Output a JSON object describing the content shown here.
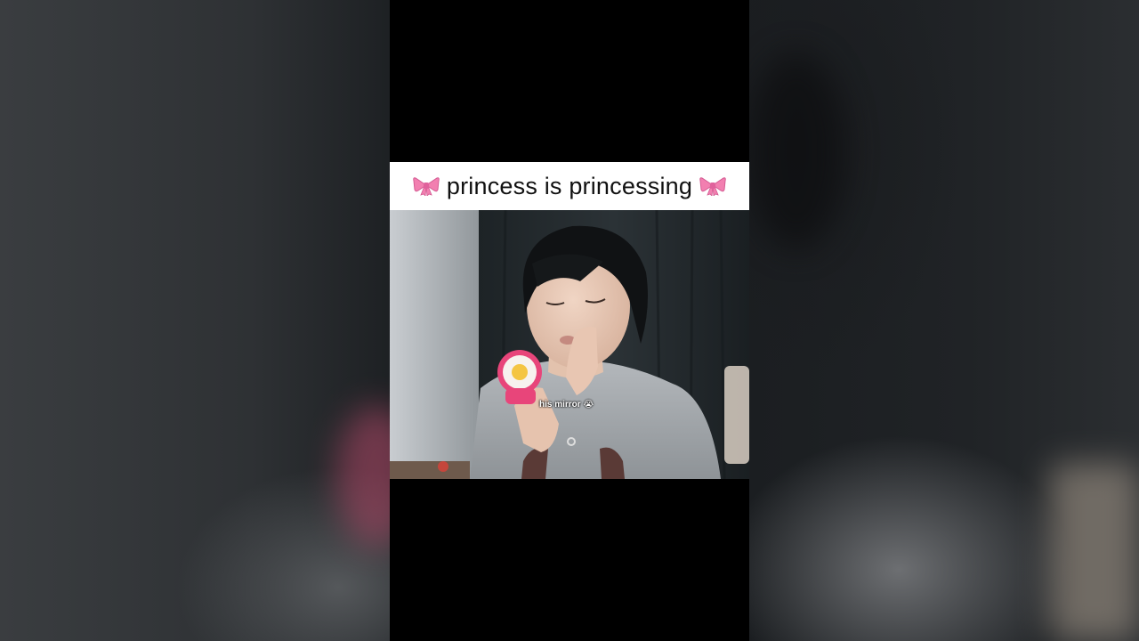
{
  "video": {
    "caption": {
      "text": "princess is princessing",
      "left_icon": "ribbon-bow-icon",
      "right_icon": "ribbon-bow-icon"
    },
    "subtitle": {
      "text": "his mirror",
      "emoji": "😭"
    }
  },
  "colors": {
    "caption_background": "#ffffff",
    "bow_pink": "#f27fb0",
    "letterbox": "#000000",
    "shirt_gray": "#9ea3a8",
    "compact_pink": "#e8457a"
  }
}
